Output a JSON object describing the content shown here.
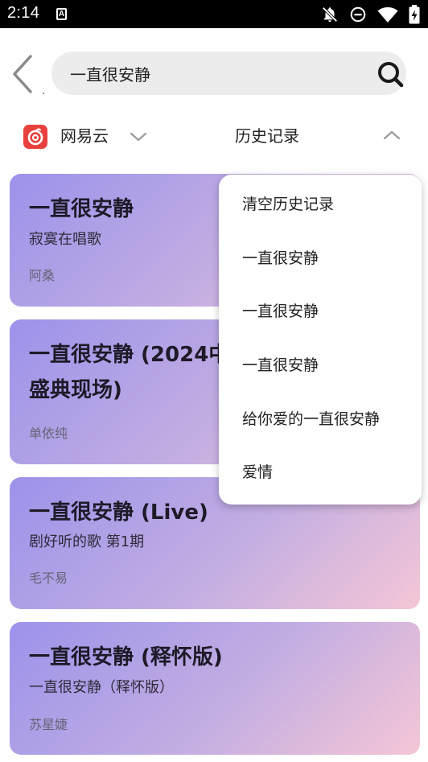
{
  "status_bar": {
    "time": "2:14",
    "notification_badge": "A",
    "icons": [
      "notifications-off-icon",
      "do-not-disturb-icon",
      "wifi-icon",
      "battery-charging-icon"
    ]
  },
  "search": {
    "query": "一直很安静"
  },
  "source": {
    "name": "网易云",
    "logo_color": "#e8403c"
  },
  "history": {
    "label": "历史记录",
    "items": [
      "清空历史记录",
      "一直很安静",
      "一直很安静",
      "一直很安静",
      "给你爱的一直很安静",
      "爱情"
    ]
  },
  "results": [
    {
      "title": "一直很安静",
      "subtitle": "寂寞在唱歌",
      "artist": "阿桑"
    },
    {
      "title_line1": "一直很安静 (2024中",
      "title_line2": "盛典现场)",
      "artist": "单依纯"
    },
    {
      "title": "一直很安静 (Live)",
      "subtitle": "剧好听的歌 第1期",
      "artist": "毛不易"
    },
    {
      "title": "一直很安静 (释怀版)",
      "subtitle": "一直很安静（释怀版）",
      "artist": "苏星婕"
    }
  ],
  "colors": {
    "card_gradient_start": "#9c92ea",
    "card_gradient_end": "#f5c6d6",
    "status_bar": "#000000",
    "search_background": "#ececec"
  }
}
